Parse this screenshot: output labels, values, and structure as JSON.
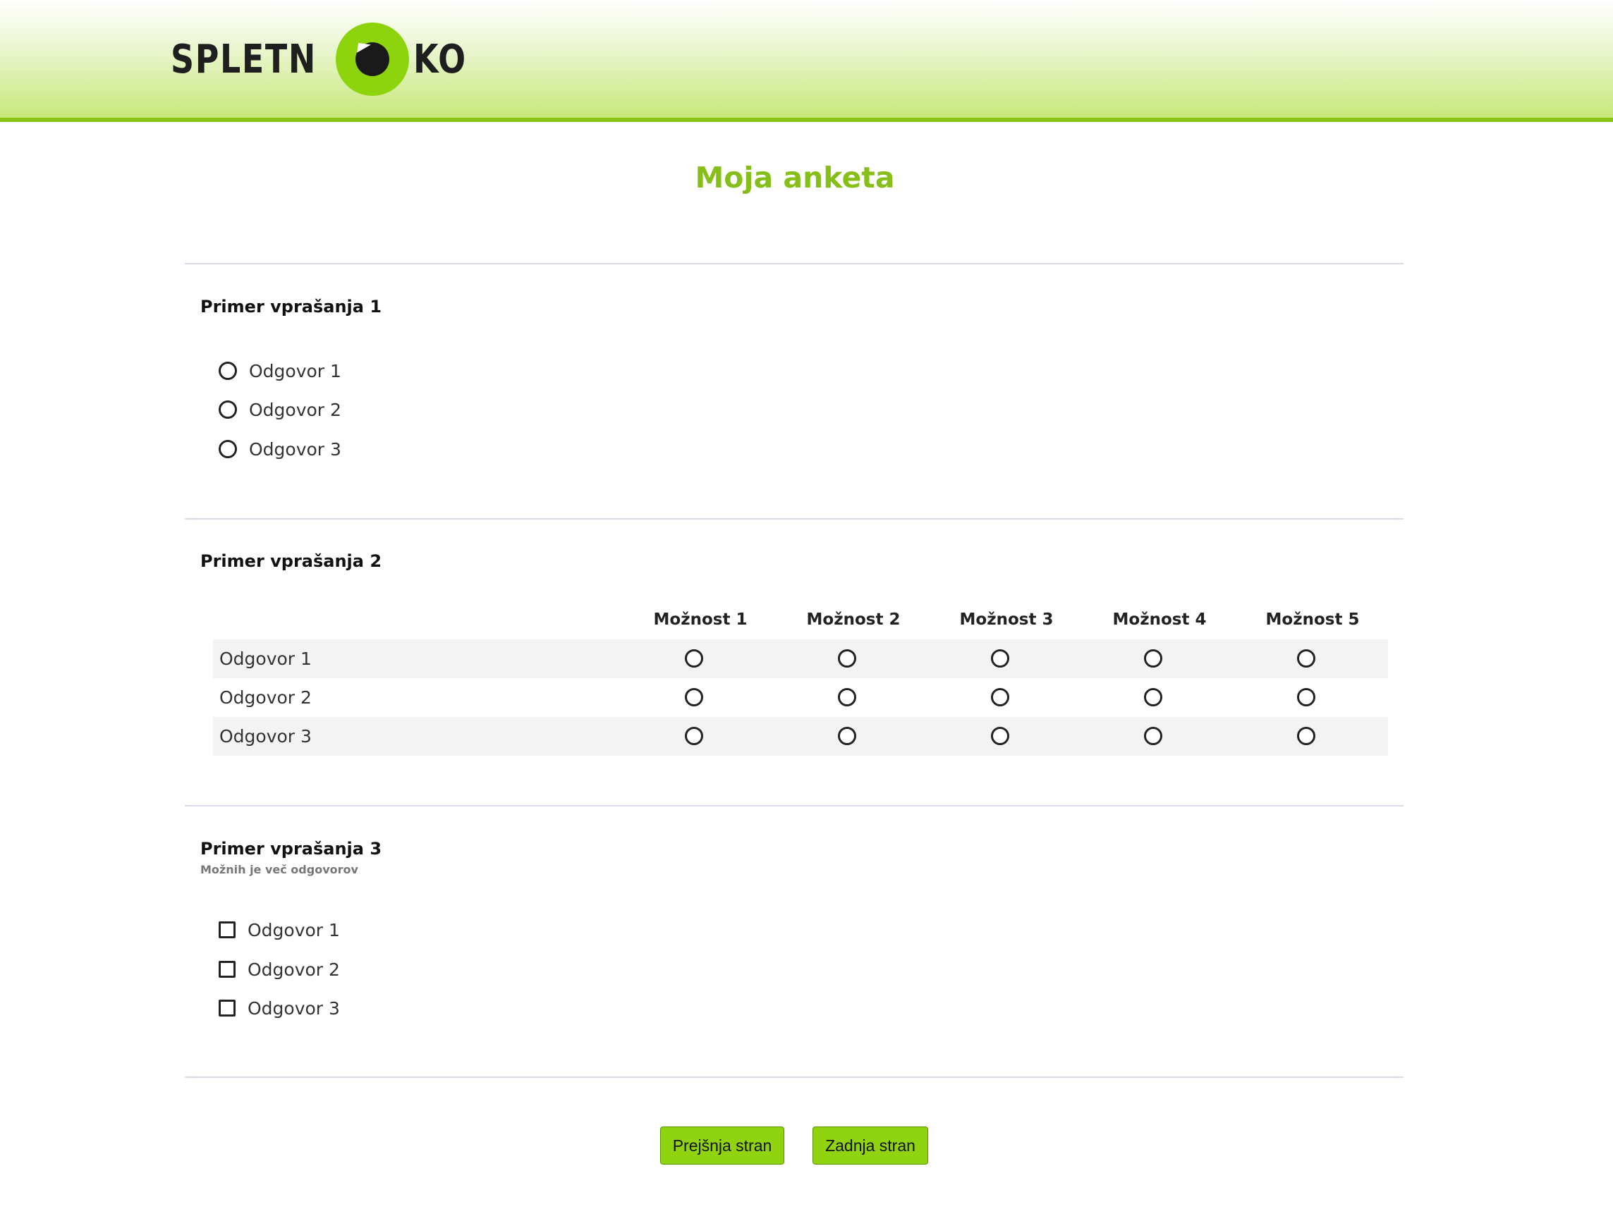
{
  "header": {
    "logo_text_left": "SPLETN",
    "logo_text_right": "KO",
    "logo_icon": "eye-icon"
  },
  "survey": {
    "title": "Moja anketa"
  },
  "question1": {
    "title": "Primer vprašanja 1",
    "options": [
      "Odgovor 1",
      "Odgovor 2",
      "Odgovor 3"
    ]
  },
  "question2": {
    "title": "Primer vprašanja 2",
    "columns": [
      "Možnost 1",
      "Možnost 2",
      "Možnost 3",
      "Možnost 4",
      "Možnost 5"
    ],
    "rows": [
      "Odgovor 1",
      "Odgovor 2",
      "Odgovor 3"
    ]
  },
  "question3": {
    "title": "Primer vprašanja 3",
    "note": "Možnih je več odgovorov",
    "options": [
      "Odgovor 1",
      "Odgovor 2",
      "Odgovor 3"
    ]
  },
  "nav": {
    "prev_label": "Prejšnja stran",
    "last_label": "Zadnja stran"
  },
  "colors": {
    "accent": "#86bf1a",
    "button": "#8fd40e",
    "header_border": "#8cc414"
  }
}
